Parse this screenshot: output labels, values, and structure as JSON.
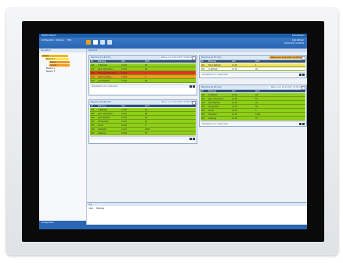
{
  "window": {
    "title": "SIMATIC WinCC",
    "right_label": "Administrator"
  },
  "toolbar": {
    "menu_items": [
      "Konfiguration",
      "Optionen",
      "Hilfe"
    ],
    "right_info": [
      "Auto Refresh",
      "10.04.2017 12:06:32"
    ]
  },
  "sidebar": {
    "header": "Navigation",
    "items": [
      {
        "label": "Anlage",
        "level": 0,
        "state": "selected"
      },
      {
        "label": "Bereich 1",
        "level": 1,
        "state": "warn"
      },
      {
        "label": "Linie A",
        "level": 2,
        "state": "alarm"
      },
      {
        "label": "Linie B",
        "level": 2,
        "state": "alarm"
      },
      {
        "label": "Bereich 2",
        "level": 1,
        "state": "normal"
      },
      {
        "label": "Bereich 3",
        "level": 1,
        "state": "normal"
      }
    ],
    "footer": "Konfiguration"
  },
  "main": {
    "header": "Übersicht"
  },
  "panels": [
    {
      "title": "Maschine 01 (ID 101)",
      "badge": "Status vom 10.04.2017 12:06:32",
      "badge_style": "normal",
      "columns": [
        "Nr.",
        "Meldung",
        "Zeit",
        "Wert"
      ],
      "rows": [
        {
          "cells": [
            "101",
            "In Betrieb",
            "12:04",
            "OK"
          ],
          "status": "green"
        },
        {
          "cells": [
            "102",
            "gem. Produktion",
            "12:03",
            "96"
          ],
          "status": "green"
        },
        {
          "cells": [
            "103",
            "Störung Förderband",
            "12:02",
            "!"
          ],
          "status": "red"
        },
        {
          "cells": [
            "104",
            "Wartung fällig",
            "11:58",
            "2"
          ],
          "status": "orange"
        },
        {
          "cells": [
            "105",
            "Auto Betrieb",
            "11:40",
            "OK"
          ],
          "status": "green"
        }
      ],
      "footer": "Aktualisiert vor 2 Sekunden"
    },
    {
      "title": "Maschine 02 (ID 102)",
      "badge": "Status vom 10.04.2017 12:06:32",
      "badge_style": "orange",
      "columns": [
        "Nr.",
        "Meldung",
        "Zeit",
        "Wert"
      ],
      "rows": [
        {
          "cells": [
            "201",
            "Hand Betrieb",
            "12:05",
            "1"
          ],
          "status": "yellow"
        },
        {
          "cells": [
            "202",
            "In Betrieb",
            "12:01",
            "OK"
          ],
          "status": "white"
        }
      ],
      "footer": "Aktualisiert vor 2 Sekunden"
    },
    {
      "title": "Maschine 03 (ID 103)",
      "badge": "Status vom 10.04.2017 12:06:32",
      "badge_style": "normal",
      "columns": [
        "Nr.",
        "Meldung",
        "Zeit",
        "Wert"
      ],
      "rows": [
        {
          "cells": [
            "301",
            "In Betrieb",
            "12:06",
            "OK"
          ],
          "status": "green"
        },
        {
          "cells": [
            "302",
            "gem. Produktion",
            "12:05",
            "88"
          ],
          "status": "green"
        },
        {
          "cells": [
            "303",
            "Auto Betrieb",
            "12:04",
            "OK"
          ],
          "status": "green"
        },
        {
          "cells": [
            "304",
            "Temperatur",
            "12:03",
            "42"
          ],
          "status": "green"
        },
        {
          "cells": [
            "305",
            "Druck",
            "12:02",
            "6"
          ],
          "status": "green"
        },
        {
          "cells": [
            "306",
            "Drehzahl",
            "12:01",
            "1200"
          ],
          "status": "green"
        },
        {
          "cells": [
            "307",
            "Leistung",
            "12:00",
            "78"
          ],
          "status": "green"
        }
      ],
      "footer": ""
    },
    {
      "title": "Maschine 04 (ID 104)",
      "badge": "Status vom 10.04.2017 12:06:32",
      "badge_style": "normal",
      "columns": [
        "Nr.",
        "Meldung",
        "Zeit",
        "Wert"
      ],
      "rows": [
        {
          "cells": [
            "401",
            "In Betrieb",
            "12:06",
            "OK"
          ],
          "status": "green"
        },
        {
          "cells": [
            "402",
            "gem. Produktion",
            "12:05",
            "91"
          ],
          "status": "green"
        },
        {
          "cells": [
            "403",
            "Auto Betrieb",
            "12:04",
            "OK"
          ],
          "status": "green"
        },
        {
          "cells": [
            "404",
            "Temperatur",
            "12:03",
            "39"
          ],
          "status": "green"
        },
        {
          "cells": [
            "405",
            "Druck",
            "12:02",
            "5"
          ],
          "status": "green"
        },
        {
          "cells": [
            "406",
            "Drehzahl",
            "12:01",
            "1180"
          ],
          "status": "green"
        },
        {
          "cells": [
            "407",
            "Leistung",
            "12:00",
            "74"
          ],
          "status": "green"
        }
      ],
      "footer": "Aktualisiert vor 2 Sekunden"
    }
  ],
  "bottom": {
    "header": "Log",
    "columns": [
      "Zeit",
      "Meldung"
    ]
  },
  "colors": {
    "green": "#8fcf1a",
    "red": "#e0331f",
    "orange": "#f39a1c",
    "yellow": "#f5e35a",
    "white": "#ffffff",
    "accent": "#2a66b3"
  }
}
